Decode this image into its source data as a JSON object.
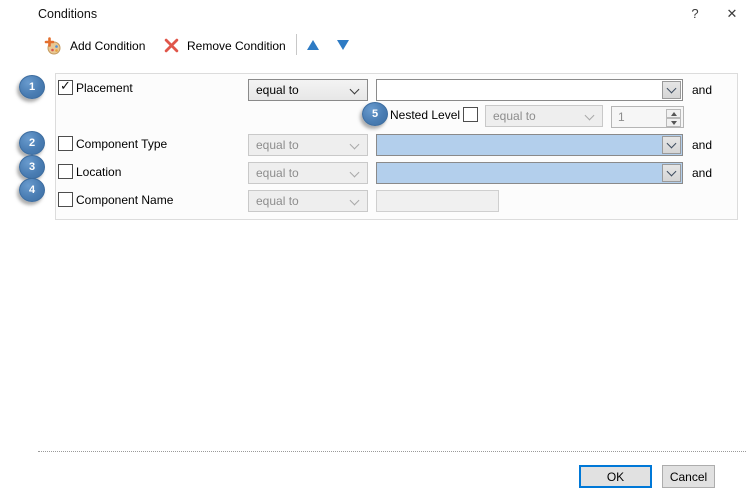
{
  "window": {
    "title": "Conditions",
    "help_glyph": "?",
    "close_glyph": "✕"
  },
  "toolbar": {
    "add_label": "Add Condition",
    "remove_label": "Remove Condition"
  },
  "colors": {
    "badge_blue": "#4a7db3",
    "toolbar_arrow_blue": "#2e7bc4",
    "remove_red": "#e0564a",
    "combo_highlight_blue": "#b3cfec",
    "ok_focus_border": "#0078d7"
  },
  "conditions": {
    "and_label": "and",
    "rows": [
      {
        "badge": "1",
        "label": "Placement",
        "checked": true,
        "operator": "equal to",
        "value": ""
      },
      {
        "badge": "2",
        "label": "Component Type",
        "checked": false,
        "operator": "equal to",
        "value": ""
      },
      {
        "badge": "3",
        "label": "Location",
        "checked": false,
        "operator": "equal to",
        "value": ""
      },
      {
        "badge": "4",
        "label": "Component Name",
        "checked": false,
        "operator": "equal to",
        "value": ""
      }
    ],
    "nested": {
      "badge": "5",
      "label": "Nested Level",
      "checked": false,
      "operator": "equal to",
      "value": "1"
    }
  },
  "footer": {
    "ok_label": "OK",
    "cancel_label": "Cancel"
  }
}
